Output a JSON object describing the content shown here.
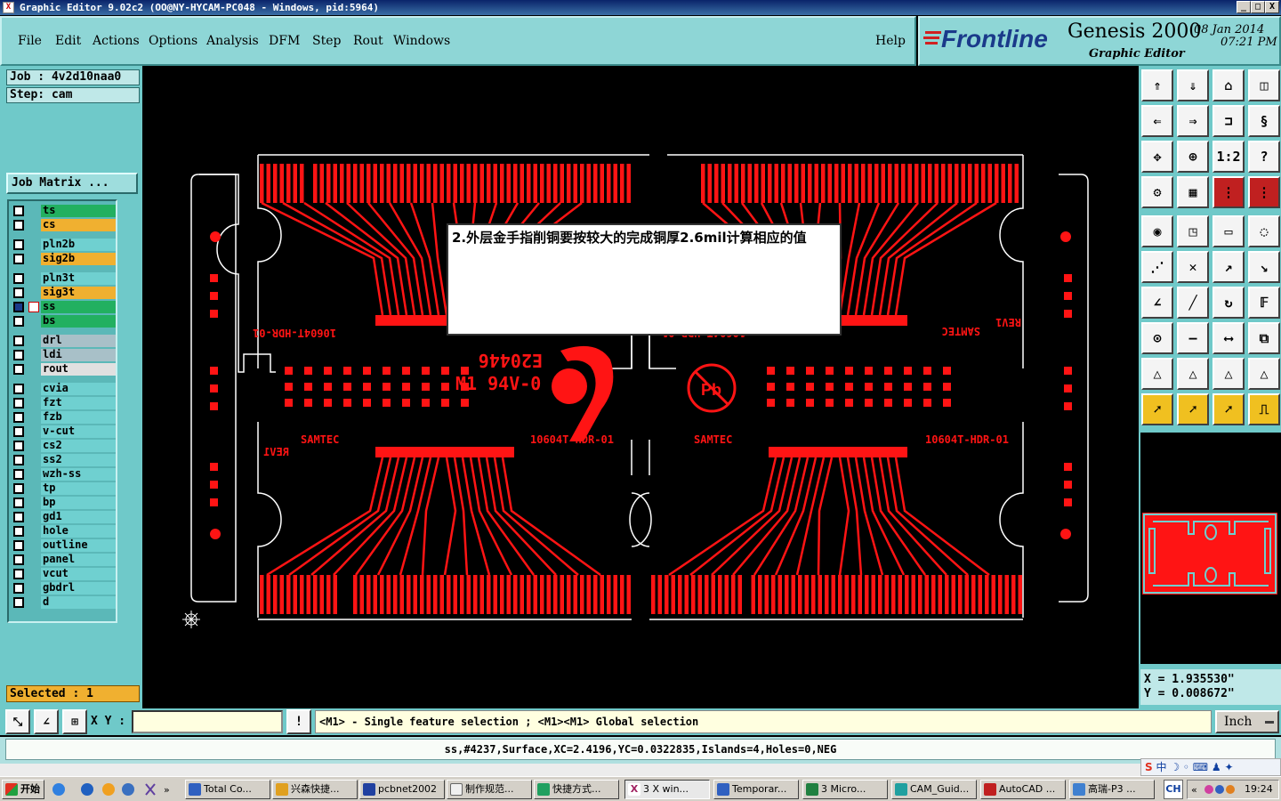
{
  "window": {
    "title": "Graphic Editor 9.02c2  (OO@NY-HYCAM-PC048 - Windows, pid:5964)",
    "controls": [
      "_",
      "□",
      "X"
    ]
  },
  "menu": {
    "items": [
      "File",
      "Edit",
      "Actions",
      "Options",
      "Analysis",
      "DFM",
      "Step",
      "Rout",
      "Windows"
    ],
    "help": "Help"
  },
  "brand": {
    "logo": "Frontline",
    "product": "Genesis 2000",
    "subtitle": "Graphic Editor",
    "date": "08 Jan 2014",
    "time": "07:21 PM"
  },
  "job": {
    "job_label": "Job : 4v2d10naa0",
    "step_label": "Step: cam",
    "matrix_button": "Job Matrix ..."
  },
  "layers": [
    {
      "name": "ts",
      "color": "#22b060"
    },
    {
      "name": "cs",
      "color": "#f0b030"
    },
    {
      "name": "pln2b",
      "color": "#6fd0d0"
    },
    {
      "name": "sig2b",
      "color": "#f0b030"
    },
    {
      "name": "pln3t",
      "color": "#6fd0d0"
    },
    {
      "name": "sig3t",
      "color": "#f0b030"
    },
    {
      "name": "ss",
      "color": "#22b060"
    },
    {
      "name": "bs",
      "color": "#22b060"
    },
    {
      "name": "drl",
      "color": "#a8c0c8"
    },
    {
      "name": "ldi",
      "color": "#a8c0c8"
    },
    {
      "name": "rout",
      "color": "#e0e0e0"
    },
    {
      "name": "cvia",
      "color": "#6fd0d0"
    },
    {
      "name": "fzt",
      "color": "#6fd0d0"
    },
    {
      "name": "fzb",
      "color": "#6fd0d0"
    },
    {
      "name": "v-cut",
      "color": "#6fd0d0"
    },
    {
      "name": "cs2",
      "color": "#6fd0d0"
    },
    {
      "name": "ss2",
      "color": "#6fd0d0"
    },
    {
      "name": "wzh-ss",
      "color": "#6fd0d0"
    },
    {
      "name": "tp",
      "color": "#6fd0d0"
    },
    {
      "name": "bp",
      "color": "#6fd0d0"
    },
    {
      "name": "gd1",
      "color": "#6fd0d0"
    },
    {
      "name": "hole",
      "color": "#6fd0d0"
    },
    {
      "name": "outline",
      "color": "#6fd0d0"
    },
    {
      "name": "panel",
      "color": "#6fd0d0"
    },
    {
      "name": "vcut",
      "color": "#6fd0d0"
    },
    {
      "name": "gbdrl",
      "color": "#6fd0d0"
    },
    {
      "name": "d",
      "color": "#6fd0d0"
    }
  ],
  "selected": "Selected : 1",
  "canvas": {
    "note": "2.外层金手指削铜要按较大的完成铜厚2.6mil计算相应的值",
    "labels": {
      "rev": "REV1",
      "samtec": "SAMTEC",
      "part": "10604T-HDR-01",
      "code1": "E20446",
      "code2": "M1 94V-0",
      "pb": "Pb"
    }
  },
  "coords": {
    "x": "X =  1.935530\"",
    "y": "Y =  0.008672\""
  },
  "command": {
    "xy_label": "X Y :",
    "xy_value": "",
    "hint": "<M1> - Single feature selection ; <M1><M1> Global selection",
    "units": "Inch"
  },
  "status": "ss,#4237,Surface,XC=2.4196,YC=0.0322835,Islands=4,Holes=0,NEG",
  "taskbar": {
    "start": "开始",
    "tasks": [
      "Total Co...",
      "兴森快捷...",
      "pcbnet2002",
      "制作规范...",
      "快捷方式...",
      "3 X win...",
      "Temporar...",
      "3 Micro...",
      "CAM_Guid...",
      "AutoCAD ...",
      "高瑞-P3 ..."
    ],
    "tray_lang": "CH",
    "clock": "19:24",
    "ime": "中"
  },
  "colors": {
    "copper": "#ff1414",
    "panel": "#6fc9c9",
    "highlight": "#f0b030"
  }
}
